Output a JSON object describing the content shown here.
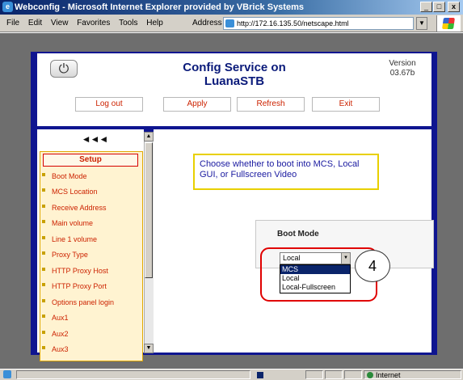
{
  "window": {
    "title": "Webconfig - Microsoft Internet Explorer provided by VBrick Systems",
    "minimize": "_",
    "maximize": "□",
    "close": "x"
  },
  "menu": [
    "File",
    "Edit",
    "View",
    "Favorites",
    "Tools",
    "Help"
  ],
  "address": {
    "label": "Address",
    "url": "http://172.16.135.50/netscape.html"
  },
  "header": {
    "title_line1": "Config Service on",
    "title_line2": "LuanaSTB",
    "version_label": "Version",
    "version_number": "03.67b",
    "buttons": [
      "Log out",
      "Apply",
      "Refresh",
      "Exit"
    ]
  },
  "sidebar": {
    "nav_arrows": "◄◄◄",
    "section": "Setup",
    "items": [
      "Boot Mode",
      "MCS Location",
      "Receive Address",
      "Main volume",
      "Line 1 volume",
      "Proxy Type",
      "HTTP Proxy Host",
      "HTTP Proxy Port",
      "Options panel login",
      "Aux1",
      "Aux2",
      "Aux3"
    ]
  },
  "main": {
    "hint": "Choose whether to boot into MCS, Local GUI, or Fullscreen Video",
    "boot_mode_label": "Boot Mode",
    "select_value": "Local",
    "options": [
      "MCS",
      "Local",
      "Local-Fullscreen"
    ],
    "highlighted_option": "MCS",
    "callout_number": "4"
  },
  "status": {
    "zone": "Internet"
  },
  "colors": {
    "frame_blue": "#0f1590",
    "accent_red": "#cc2200",
    "menu_bg": "#fff3d1",
    "title_blue": "#0a1a7a"
  }
}
